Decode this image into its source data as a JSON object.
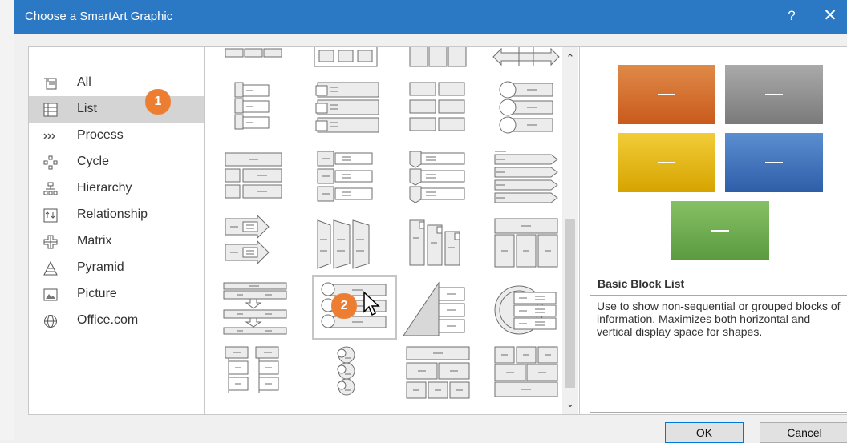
{
  "window": {
    "title": "Choose a SmartArt Graphic",
    "help": "?",
    "close": "✕"
  },
  "categories": [
    {
      "label": "All",
      "icon": "all-icon"
    },
    {
      "label": "List",
      "icon": "list-icon",
      "selected": true
    },
    {
      "label": "Process",
      "icon": "process-icon"
    },
    {
      "label": "Cycle",
      "icon": "cycle-icon"
    },
    {
      "label": "Hierarchy",
      "icon": "hierarchy-icon"
    },
    {
      "label": "Relationship",
      "icon": "relationship-icon"
    },
    {
      "label": "Matrix",
      "icon": "matrix-icon"
    },
    {
      "label": "Pyramid",
      "icon": "pyramid-icon"
    },
    {
      "label": "Picture",
      "icon": "picture-icon"
    },
    {
      "label": "Office.com",
      "icon": "globe-icon"
    }
  ],
  "gallery": {
    "scroll_up": "⌃",
    "scroll_down": "⌄",
    "selected_index": 13
  },
  "preview": {
    "name": "Basic Block List",
    "description": "Use to show non-sequential or grouped blocks of information. Maximizes both horizontal and vertical display space for shapes.",
    "colors": [
      "#d86a2a",
      "#8c8c8c",
      "#e0b000",
      "#3d6fb8",
      "#6aa84f"
    ]
  },
  "buttons": {
    "ok": "OK",
    "cancel": "Cancel"
  },
  "badges": {
    "one": "1",
    "two": "2"
  }
}
